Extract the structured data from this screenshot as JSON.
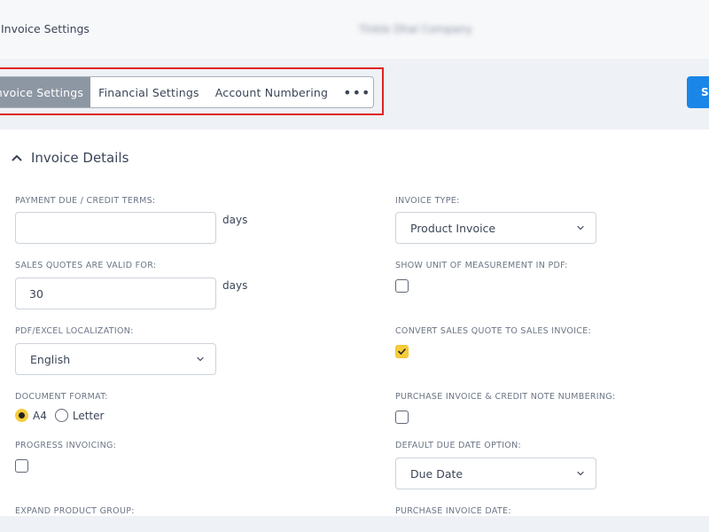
{
  "header": {
    "title": "Invoice Settings",
    "company_name": "Tinkle Dhal Company"
  },
  "tabs": [
    {
      "label": "Invoice Settings",
      "active": true
    },
    {
      "label": "Financial Settings",
      "active": false
    },
    {
      "label": "Account Numbering",
      "active": false
    }
  ],
  "more_label": "•••",
  "save_label": "S",
  "section": {
    "title": "Invoice Details",
    "icon": "chevron-up-icon"
  },
  "fields": {
    "payment_due": {
      "label": "PAYMENT DUE / CREDIT TERMS:",
      "value": "",
      "suffix": "days"
    },
    "quotes_valid": {
      "label": "SALES QUOTES ARE VALID FOR:",
      "value": "30",
      "suffix": "days"
    },
    "localization": {
      "label": "PDF/EXCEL LOCALIZATION:",
      "value": "English"
    },
    "document_format": {
      "label": "DOCUMENT FORMAT:",
      "options": [
        "A4",
        "Letter"
      ],
      "selected": "A4"
    },
    "progress_invoicing": {
      "label": "PROGRESS INVOICING:",
      "checked": false
    },
    "expand_product_group": {
      "label": "EXPAND PRODUCT GROUP:"
    },
    "invoice_type": {
      "label": "INVOICE TYPE:",
      "value": "Product Invoice"
    },
    "show_unit": {
      "label": "SHOW UNIT OF MEASUREMENT IN PDF:",
      "checked": false
    },
    "convert_quote": {
      "label": "CONVERT SALES QUOTE TO SALES INVOICE:",
      "checked": true
    },
    "purchase_numbering": {
      "label": "PURCHASE INVOICE & CREDIT NOTE NUMBERING:",
      "checked": false
    },
    "default_due_date": {
      "label": "DEFAULT DUE DATE OPTION:",
      "value": "Due Date"
    },
    "purchase_invoice_date": {
      "label": "PURCHASE INVOICE DATE:"
    }
  },
  "colors": {
    "accent": "#f6cc3a",
    "primary_button": "#1a86e8",
    "active_tab": "#8d96a3",
    "highlight_border": "#e02424"
  }
}
